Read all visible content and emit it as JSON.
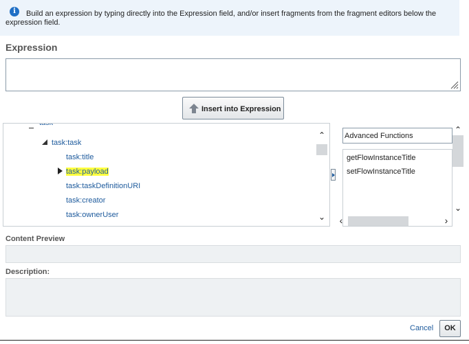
{
  "info": {
    "icon": "info-icon",
    "text": "Build an expression by typing directly into the Expression field, and/or insert fragments from the fragment editors below the expression field."
  },
  "expression": {
    "title": "Expression",
    "value": ""
  },
  "insert_button": {
    "label": "Insert into Expression",
    "icon": "up-arrow-icon"
  },
  "tree": {
    "cut_off_label": "task",
    "nodes": [
      {
        "label": "task:task",
        "state": "expanded"
      },
      {
        "label": "task:title"
      },
      {
        "label": "task:payload",
        "state": "collapsed",
        "highlighted": true
      },
      {
        "label": "task:taskDefinitionURI"
      },
      {
        "label": "task:creator"
      },
      {
        "label": "task:ownerUser"
      }
    ]
  },
  "functions": {
    "category": "Advanced Functions",
    "items": [
      "getFlowInstanceTitle",
      "setFlowInstanceTitle"
    ]
  },
  "content_preview": {
    "label": "Content Preview",
    "value": ""
  },
  "description": {
    "label": "Description:",
    "value": ""
  },
  "footer": {
    "cancel": "Cancel",
    "ok": "OK"
  },
  "colors": {
    "link": "#1d5a9c",
    "highlight": "#ffff3d",
    "banner": "#edf4fb",
    "info_icon": "#1f6fc5"
  }
}
